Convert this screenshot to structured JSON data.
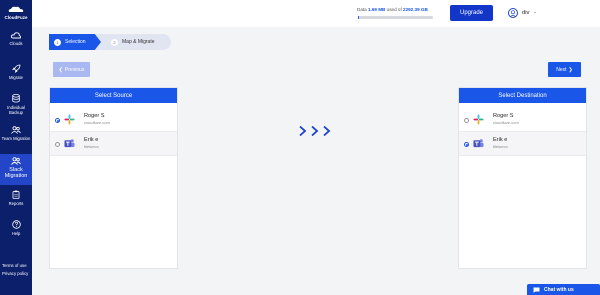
{
  "brand": {
    "name": "CloudFuze"
  },
  "sidebar": {
    "items": [
      {
        "label": "Clouds",
        "icon": "cloud-icon"
      },
      {
        "label": "Migrate",
        "icon": "rocket-icon"
      },
      {
        "label": "Individual Backup",
        "icon": "database-icon"
      },
      {
        "label": "Team Migration",
        "icon": "team-icon"
      },
      {
        "label": "Slack Migration",
        "icon": "slack-migration-icon"
      },
      {
        "label": "Reports",
        "icon": "clipboard-icon"
      },
      {
        "label": "Help",
        "icon": "help-icon"
      }
    ],
    "footer": {
      "terms": "Terms of use",
      "privacy": "Privacy policy"
    }
  },
  "header": {
    "storage_prefix": "Data",
    "storage_used": "1.69 MB",
    "storage_mid": "used of",
    "storage_total": "2292.39 GB",
    "storage_fraction": 0.01,
    "upgrade_label": "Upgrade",
    "user_name": "div"
  },
  "steps": [
    {
      "number": "1",
      "label": "Selection"
    },
    {
      "number": "2",
      "label": "Map & Migrate"
    }
  ],
  "nav": {
    "previous_label": "Previous",
    "next_label": "Next"
  },
  "source": {
    "title": "Select Source",
    "rows": [
      {
        "name": "Roger S",
        "sub": "cloudfuze.com",
        "app": "slack",
        "selected": true
      },
      {
        "name": "Erik e",
        "sub": "filelueco",
        "app": "teams",
        "selected": false
      }
    ]
  },
  "destination": {
    "title": "Select Destination",
    "rows": [
      {
        "name": "Roger S",
        "sub": "cloudfuze.com",
        "app": "slack",
        "selected": false
      },
      {
        "name": "Erik e",
        "sub": "filelueco",
        "app": "teams",
        "selected": true
      }
    ]
  },
  "chat": {
    "label": "Chat with us"
  },
  "colors": {
    "primary": "#1a56e8",
    "sidebar": "#0b1f6b",
    "active": "#2346c8"
  }
}
